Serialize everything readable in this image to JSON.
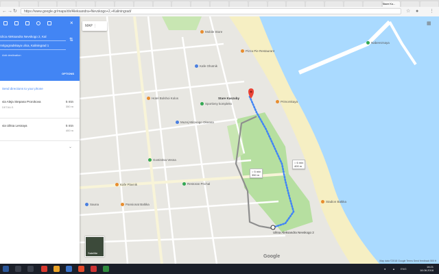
{
  "browser": {
    "url": "https://www.google.gr/maps/dir/Aleksandra+Nevskogo+2,+Kaliningrad/",
    "active_tab": "Stare Ko...",
    "tab_count": 23
  },
  "directions_panel": {
    "waypoints": [
      {
        "text": "Ulica Aleksandra Nevskogo 2, Kal"
      },
      {
        "text": "Volgogradskaya ulica, Kaliningrad 1"
      }
    ],
    "add_destination": "Add destination",
    "options_label": "OPTIONS",
    "send_label": "Send directions to your phone",
    "routes": [
      {
        "via": "via Aleja Stepana Prorokova",
        "time": "5 min",
        "distance": "350 m"
      },
      {
        "via": "via Ulitsa Lesnaya",
        "time": "5 min",
        "distance": "400 m"
      }
    ]
  },
  "map": {
    "menu_label": "MAP",
    "destination_label": "Stare Kaszuby",
    "origin_label": "Ulitsa Aleksandra Nevskogo 2",
    "walk_box_1": {
      "time": "5 min",
      "distance": "350 m"
    },
    "walk_box_2": {
      "time": "6 min",
      "distance": "400 m"
    },
    "satellite_label": "Satellite",
    "logo_text": "Google",
    "footer": "Map data ©2018 Google   Terms   Send feedback   500 ft",
    "places": [
      {
        "name": "Mobile Store"
      },
      {
        "name": "Pizza Pie Restaurant"
      },
      {
        "name": "Kafe Ohotnik"
      },
      {
        "name": "Hotel Bolshoi Kolos"
      },
      {
        "name": "Sportivny kompleks"
      },
      {
        "name": "Primorskaya"
      },
      {
        "name": "Muzej Mirovogo Okeana"
      },
      {
        "name": "Gostinitsa Vesna"
      },
      {
        "name": "Kafe Plavnik"
      },
      {
        "name": "Restoran Prichal"
      },
      {
        "name": "Sauna"
      },
      {
        "name": "Pansionat Baltika"
      },
      {
        "name": "Stadion Baltika"
      },
      {
        "name": "Nabereznaya"
      }
    ]
  },
  "taskbar": {
    "time": "16:21",
    "date": "18.08.2018",
    "lang": "ENG"
  }
}
